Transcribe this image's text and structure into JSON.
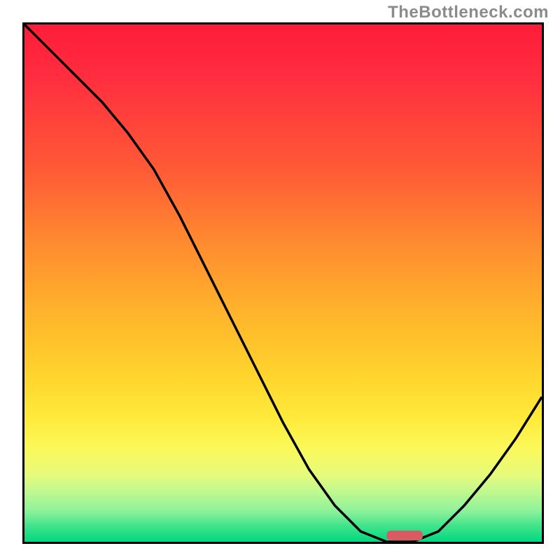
{
  "watermark": "TheBottleneck.com",
  "chart_data": {
    "type": "line",
    "title": "",
    "xlabel": "",
    "ylabel": "",
    "xlim": [
      0,
      100
    ],
    "ylim": [
      0,
      100
    ],
    "grid": false,
    "legend": false,
    "background_gradient": {
      "top": "#ff1c3a",
      "mid": "#ffd22c",
      "bottom": "#00d87f"
    },
    "series": [
      {
        "name": "curve",
        "x": [
          0,
          5,
          10,
          15,
          20,
          25,
          30,
          35,
          40,
          45,
          50,
          55,
          60,
          65,
          70,
          75,
          80,
          85,
          90,
          95,
          100
        ],
        "values": [
          100,
          95,
          90,
          85,
          79,
          72,
          63,
          53,
          43,
          33,
          23,
          14,
          7,
          2,
          0,
          0,
          2,
          7,
          13,
          20,
          28
        ]
      }
    ],
    "marker": {
      "description": "rounded segment on baseline near curve minimum",
      "x_start": 70,
      "x_end": 77,
      "y": 0,
      "color": "#d85a62"
    },
    "axis_ticks_visible": false
  }
}
